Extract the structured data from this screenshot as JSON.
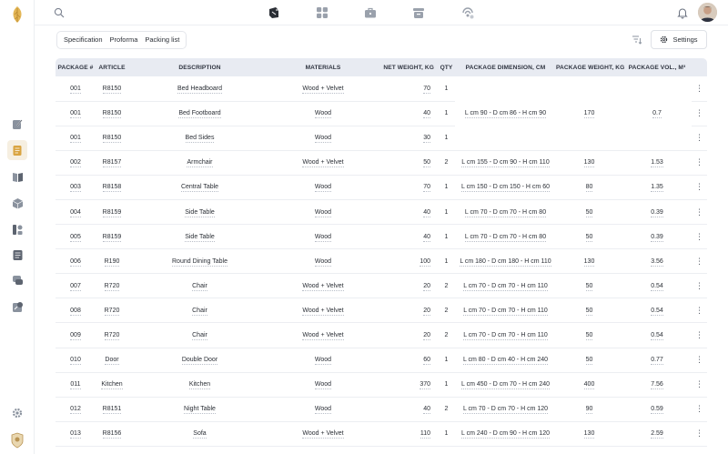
{
  "colors": {
    "accent": "#d9a441",
    "header_bg": "#e8ebf2",
    "text": "#2b2f36"
  },
  "rail": {
    "logo": "leaf-logo",
    "items": [
      {
        "icon": "edit-doc-icon",
        "active": false
      },
      {
        "icon": "document-icon",
        "active": true
      },
      {
        "icon": "book-icon",
        "active": false
      },
      {
        "icon": "box-icon",
        "active": false
      },
      {
        "icon": "shapes-icon",
        "active": false
      },
      {
        "icon": "list-doc-icon",
        "active": false
      },
      {
        "icon": "chat-icon",
        "active": false
      },
      {
        "icon": "tools-icon",
        "active": false
      }
    ],
    "bottom": [
      "gear-icon",
      "brand-crest"
    ]
  },
  "topbar": {
    "nav": [
      "cube-icon",
      "grid-icon",
      "briefcase-icon",
      "archive-icon",
      "signal-icon"
    ]
  },
  "subbar": {
    "tabs": [
      "Specification",
      "Proforma",
      "Packing list"
    ],
    "settings_label": "Settings"
  },
  "table": {
    "columns": [
      "PACKAGE #",
      "ARTICLE",
      "DESCRIPTION",
      "MATERIALS",
      "NET WEIGHT, KG",
      "QTY",
      "PACKAGE DIMENSION, CM",
      "PACKAGE WEIGHT, KG",
      "PACKAGE VOL., M³"
    ],
    "group1": {
      "dimension": "L cm 90 - D cm 86 - H cm 90",
      "weight": "170",
      "volume": "0.7",
      "rows": [
        {
          "pkg": "001",
          "article": "R8150",
          "desc": "Bed Headboard",
          "mat": "Wood + Velvet",
          "net": "70",
          "qty": "1"
        },
        {
          "pkg": "001",
          "article": "R8150",
          "desc": "Bed Footboard",
          "mat": "Wood",
          "net": "40",
          "qty": "1"
        },
        {
          "pkg": "001",
          "article": "R8150",
          "desc": "Bed Sides",
          "mat": "Wood",
          "net": "30",
          "qty": "1"
        }
      ]
    },
    "rows": [
      {
        "pkg": "002",
        "article": "R8157",
        "desc": "Armchair",
        "mat": "Wood + Velvet",
        "net": "50",
        "qty": "2",
        "dim": "L cm 155 - D cm 90 - H cm 110",
        "pw": "130",
        "vol": "1.53"
      },
      {
        "pkg": "003",
        "article": "R8158",
        "desc": "Central Table",
        "mat": "Wood",
        "net": "70",
        "qty": "1",
        "dim": "L cm 150 - D cm 150 - H cm 60",
        "pw": "80",
        "vol": "1.35"
      },
      {
        "pkg": "004",
        "article": "R8159",
        "desc": "Side Table",
        "mat": "Wood",
        "net": "40",
        "qty": "1",
        "dim": "L cm 70 - D cm 70 - H cm 80",
        "pw": "50",
        "vol": "0.39"
      },
      {
        "pkg": "005",
        "article": "R8159",
        "desc": "Side Table",
        "mat": "Wood",
        "net": "40",
        "qty": "1",
        "dim": "L cm 70 - D cm 70 - H cm 80",
        "pw": "50",
        "vol": "0.39"
      },
      {
        "pkg": "006",
        "article": "R190",
        "desc": "Round Dining Table",
        "mat": "Wood",
        "net": "100",
        "qty": "1",
        "dim": "L cm 180 - D cm 180 - H cm 110",
        "pw": "130",
        "vol": "3.56"
      },
      {
        "pkg": "007",
        "article": "R720",
        "desc": "Chair",
        "mat": "Wood + Velvet",
        "net": "20",
        "qty": "2",
        "dim": "L cm 70 - D cm 70 - H cm 110",
        "pw": "50",
        "vol": "0.54"
      },
      {
        "pkg": "008",
        "article": "R720",
        "desc": "Chair",
        "mat": "Wood + Velvet",
        "net": "20",
        "qty": "2",
        "dim": "L cm 70 - D cm 70 - H cm 110",
        "pw": "50",
        "vol": "0.54"
      },
      {
        "pkg": "009",
        "article": "R720",
        "desc": "Chair",
        "mat": "Wood + Velvet",
        "net": "20",
        "qty": "2",
        "dim": "L cm 70 - D cm 70 - H cm 110",
        "pw": "50",
        "vol": "0.54"
      },
      {
        "pkg": "010",
        "article": "Door",
        "desc": "Double Door",
        "mat": "Wood",
        "net": "60",
        "qty": "1",
        "dim": "L cm 80 - D cm 40 - H cm 240",
        "pw": "50",
        "vol": "0.77"
      },
      {
        "pkg": "011",
        "article": "Kitchen",
        "desc": "Kitchen",
        "mat": "Wood",
        "net": "370",
        "qty": "1",
        "dim": "L cm 450 - D cm 70 - H cm 240",
        "pw": "400",
        "vol": "7.56"
      },
      {
        "pkg": "012",
        "article": "R8151",
        "desc": "Night Table",
        "mat": "Wood",
        "net": "40",
        "qty": "2",
        "dim": "L cm 70 - D cm 70 - H cm 120",
        "pw": "90",
        "vol": "0.59"
      },
      {
        "pkg": "013",
        "article": "R8156",
        "desc": "Sofa",
        "mat": "Wood + Velvet",
        "net": "110",
        "qty": "1",
        "dim": "L cm 240 - D cm 90 - H cm 120",
        "pw": "130",
        "vol": "2.59"
      }
    ]
  }
}
